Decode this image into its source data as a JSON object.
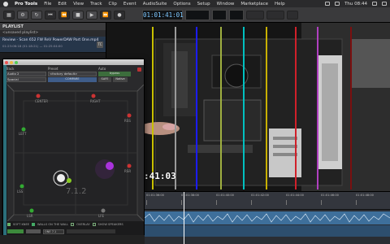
{
  "menubar": {
    "app_name": "Pro Tools",
    "items": [
      "File",
      "Edit",
      "View",
      "Track",
      "Clip",
      "Event",
      "AudioSuite",
      "Options",
      "Setup",
      "Window",
      "Marketplace",
      "Help"
    ],
    "clock": "Thu 08:44"
  },
  "transport": {
    "counter": "01:01:41:01"
  },
  "playlist": {
    "header": "PLAYLIST",
    "subheader": "<unsaved playlist>",
    "item_title": "Review - Scan 652 FW ReV PowerDAW Part One.mp4",
    "item_sub": "01:23:06:18 (01:18:21) — 01:25:04:00",
    "item_button": "TC"
  },
  "panner": {
    "track_label": "Track",
    "track_value": "Audio 2",
    "preset_label": "Preset",
    "preset_value": "<factory default>",
    "auto_label": "Auto",
    "auto_value": "bypass",
    "mode_value": "Spacial",
    "compare_label": "COMPARE",
    "safe_label": "SAFE",
    "native_label": "Native",
    "speakers": [
      "CENTER",
      "RIGHT",
      "LEFT",
      "RSS",
      "LSS",
      "RSR",
      "LSR",
      "LFE",
      "LTS",
      "RTS"
    ],
    "foot": [
      "SOFT KNEE",
      "WALLS ON THE WALL",
      "OVERLAY",
      "SHOW SPEAKERS"
    ],
    "bottom_select": "ONE 7.1"
  },
  "video": {
    "timecode_overlay": ":41:03"
  },
  "timeline": {
    "ticks": [
      "01:01:36:00",
      "01:01:38:00",
      "01:01:40:00",
      "01:01:42:00",
      "01:01:44:00",
      "01:01:46:00",
      "01:01:48:00"
    ]
  },
  "colors": {
    "accent_blue": "#3e6f9b",
    "counter_text": "#7ec8ff"
  }
}
